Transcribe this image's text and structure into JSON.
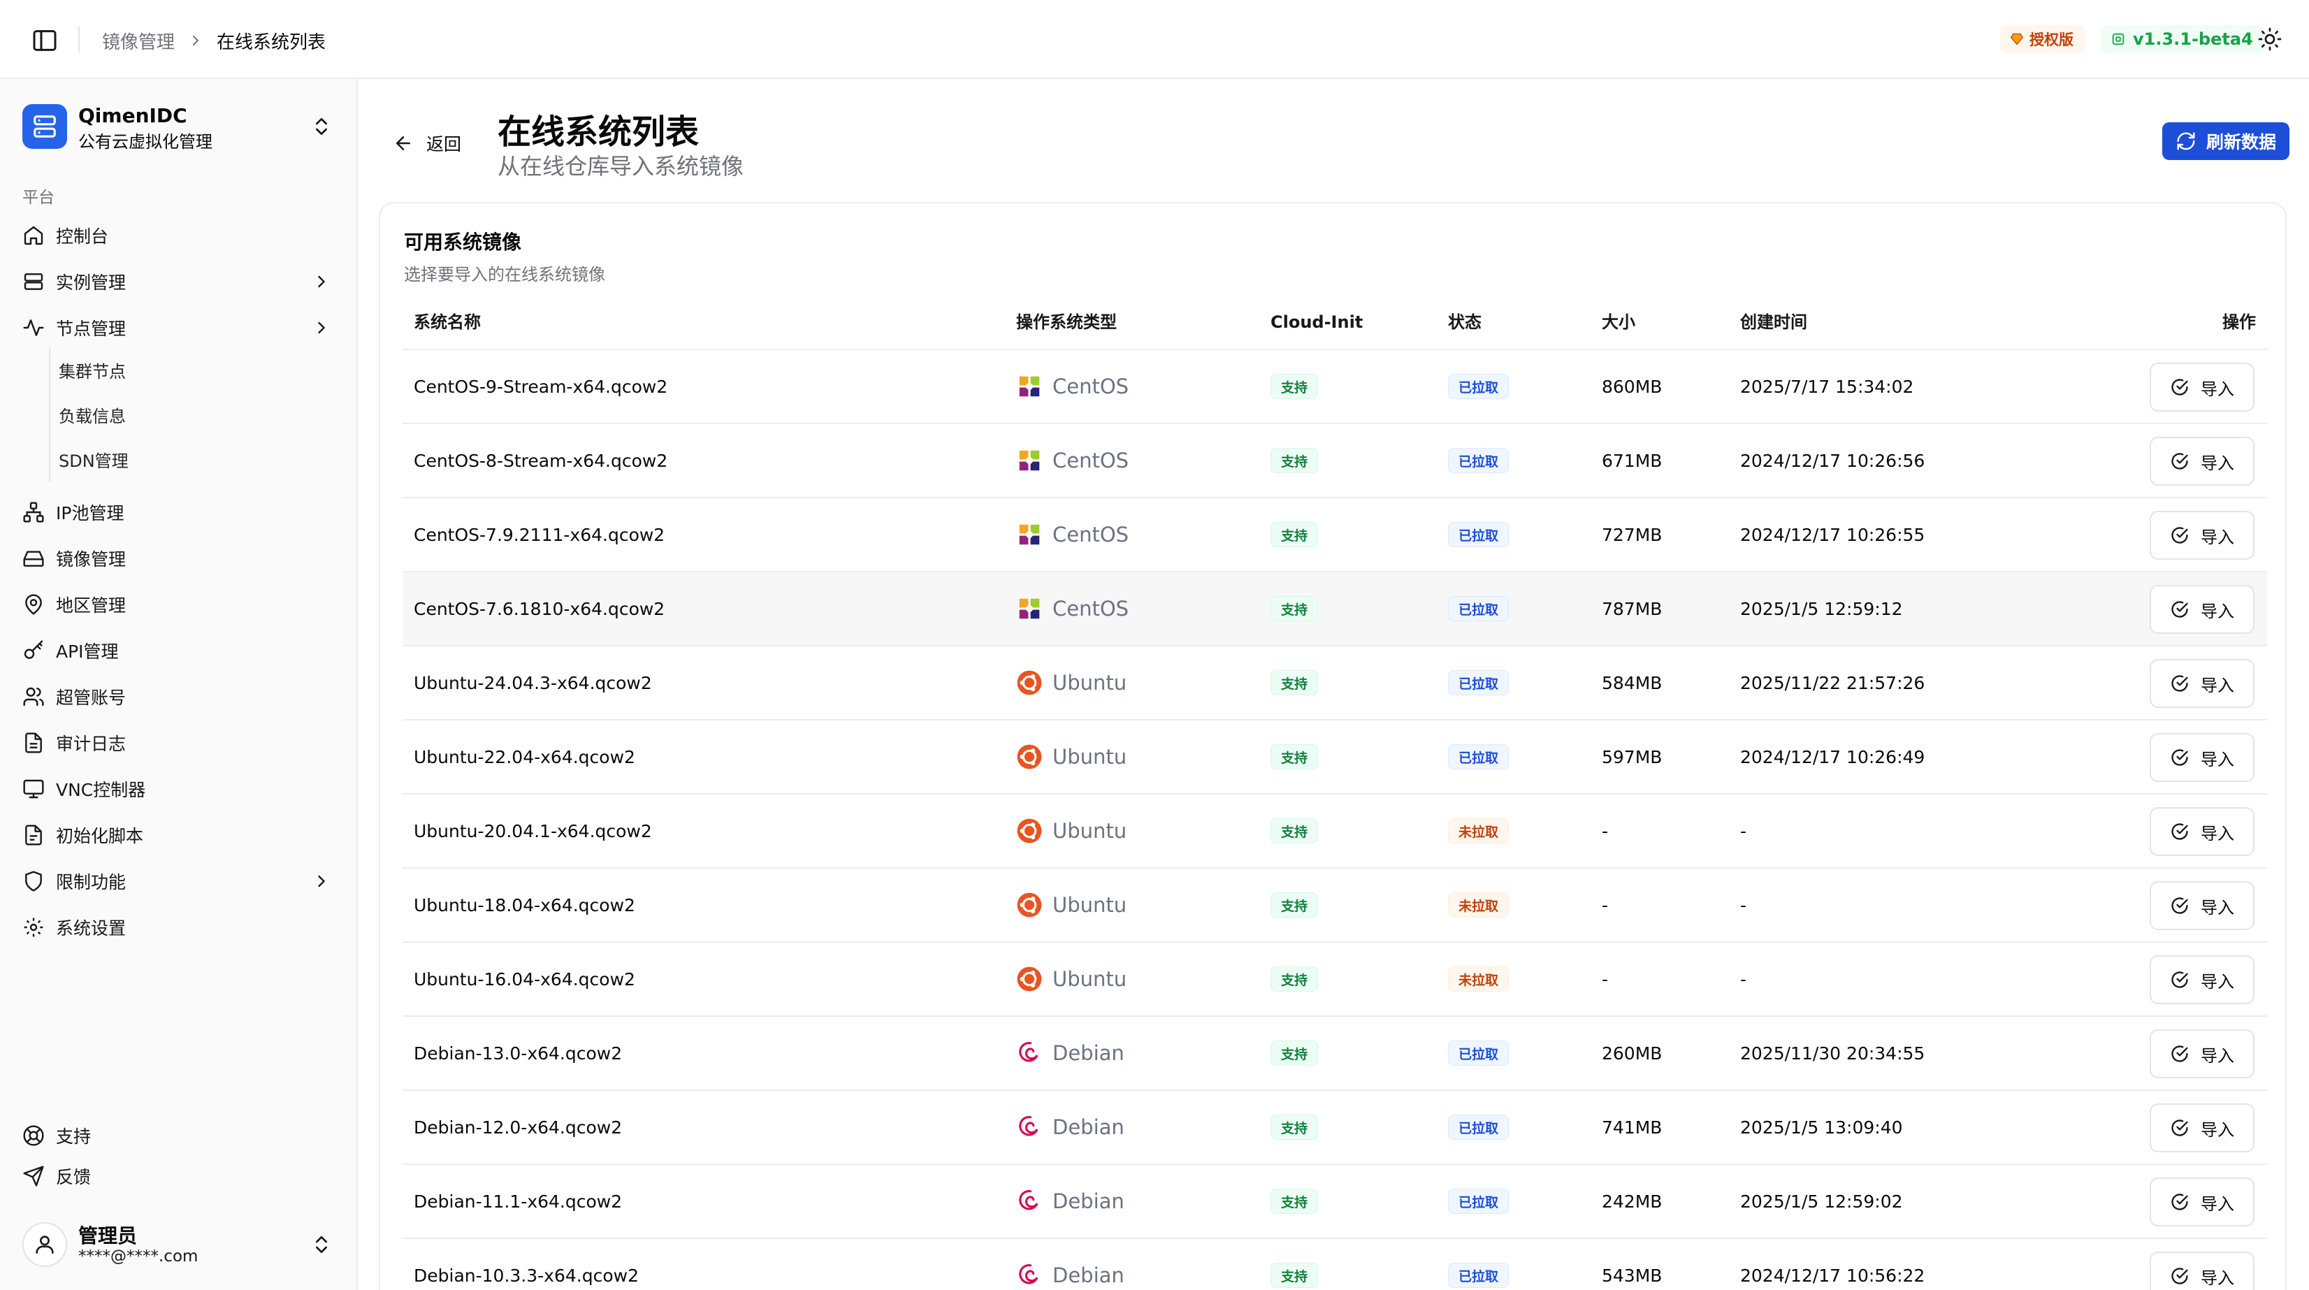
{
  "topbar": {
    "breadcrumb_parent": "镜像管理",
    "breadcrumb_current": "在线系统列表",
    "license_badge": "授权版",
    "version_badge": "v1.3.1-beta4"
  },
  "sidebar": {
    "brand_name": "QimenIDC",
    "brand_sub": "公有云虚拟化管理",
    "group_label": "平台",
    "items": [
      {
        "label": "控制台",
        "icon": "home-icon"
      },
      {
        "label": "实例管理",
        "icon": "server-icon",
        "has_children": true
      },
      {
        "label": "节点管理",
        "icon": "activity-icon",
        "has_children": true,
        "expanded": true
      },
      {
        "label": "IP池管理",
        "icon": "network-icon"
      },
      {
        "label": "镜像管理",
        "icon": "hard-drive-icon"
      },
      {
        "label": "地区管理",
        "icon": "map-pin-icon"
      },
      {
        "label": "API管理",
        "icon": "key-icon"
      },
      {
        "label": "超管账号",
        "icon": "users-icon"
      },
      {
        "label": "审计日志",
        "icon": "file-text-icon"
      },
      {
        "label": "VNC控制器",
        "icon": "monitor-icon"
      },
      {
        "label": "初始化脚本",
        "icon": "file-code-icon"
      },
      {
        "label": "限制功能",
        "icon": "shield-icon",
        "has_children": true
      },
      {
        "label": "系统设置",
        "icon": "settings-icon"
      }
    ],
    "node_children": [
      "集群节点",
      "负载信息",
      "SDN管理"
    ],
    "footer": [
      {
        "label": "支持",
        "icon": "life-buoy-icon"
      },
      {
        "label": "反馈",
        "icon": "send-icon"
      }
    ],
    "user": {
      "name": "管理员",
      "email": "****@****.com"
    }
  },
  "main": {
    "back_label": "返回",
    "title": "在线系统列表",
    "subtitle": "从在线仓库导入系统镜像",
    "refresh_label": "刷新数据",
    "card_title": "可用系统镜像",
    "card_subtitle": "选择要导入的在线系统镜像",
    "columns": [
      "系统名称",
      "操作系统类型",
      "Cloud-Init",
      "状态",
      "大小",
      "创建时间",
      "操作"
    ],
    "import_label": "导入",
    "rows": [
      {
        "name": "CentOS-9-Stream-x64.qcow2",
        "os": "CentOS",
        "cloudinit": "支持",
        "status": "已拉取",
        "status_kind": "pulled",
        "size": "860MB",
        "created": "2025/7/17 15:34:02"
      },
      {
        "name": "CentOS-8-Stream-x64.qcow2",
        "os": "CentOS",
        "cloudinit": "支持",
        "status": "已拉取",
        "status_kind": "pulled",
        "size": "671MB",
        "created": "2024/12/17 10:26:56"
      },
      {
        "name": "CentOS-7.9.2111-x64.qcow2",
        "os": "CentOS",
        "cloudinit": "支持",
        "status": "已拉取",
        "status_kind": "pulled",
        "size": "727MB",
        "created": "2024/12/17 10:26:55"
      },
      {
        "name": "CentOS-7.6.1810-x64.qcow2",
        "os": "CentOS",
        "cloudinit": "支持",
        "status": "已拉取",
        "status_kind": "pulled",
        "size": "787MB",
        "created": "2025/1/5 12:59:12",
        "hover": true
      },
      {
        "name": "Ubuntu-24.04.3-x64.qcow2",
        "os": "Ubuntu",
        "cloudinit": "支持",
        "status": "已拉取",
        "status_kind": "pulled",
        "size": "584MB",
        "created": "2025/11/22 21:57:26"
      },
      {
        "name": "Ubuntu-22.04-x64.qcow2",
        "os": "Ubuntu",
        "cloudinit": "支持",
        "status": "已拉取",
        "status_kind": "pulled",
        "size": "597MB",
        "created": "2024/12/17 10:26:49"
      },
      {
        "name": "Ubuntu-20.04.1-x64.qcow2",
        "os": "Ubuntu",
        "cloudinit": "支持",
        "status": "未拉取",
        "status_kind": "notpulled",
        "size": "-",
        "created": "-"
      },
      {
        "name": "Ubuntu-18.04-x64.qcow2",
        "os": "Ubuntu",
        "cloudinit": "支持",
        "status": "未拉取",
        "status_kind": "notpulled",
        "size": "-",
        "created": "-"
      },
      {
        "name": "Ubuntu-16.04-x64.qcow2",
        "os": "Ubuntu",
        "cloudinit": "支持",
        "status": "未拉取",
        "status_kind": "notpulled",
        "size": "-",
        "created": "-"
      },
      {
        "name": "Debian-13.0-x64.qcow2",
        "os": "Debian",
        "cloudinit": "支持",
        "status": "已拉取",
        "status_kind": "pulled",
        "size": "260MB",
        "created": "2025/11/30 20:34:55"
      },
      {
        "name": "Debian-12.0-x64.qcow2",
        "os": "Debian",
        "cloudinit": "支持",
        "status": "已拉取",
        "status_kind": "pulled",
        "size": "741MB",
        "created": "2025/1/5 13:09:40"
      },
      {
        "name": "Debian-11.1-x64.qcow2",
        "os": "Debian",
        "cloudinit": "支持",
        "status": "已拉取",
        "status_kind": "pulled",
        "size": "242MB",
        "created": "2025/1/5 12:59:02"
      },
      {
        "name": "Debian-10.3.3-x64.qcow2",
        "os": "Debian",
        "cloudinit": "支持",
        "status": "已拉取",
        "status_kind": "pulled",
        "size": "543MB",
        "created": "2024/12/17 10:56:22"
      }
    ]
  },
  "colors": {
    "accent": "#1d4ed8",
    "brand": "#2563eb",
    "success": "#15803d",
    "pulled": "#1d4ed8",
    "not_pulled": "#c2410c",
    "license": "#c2410c",
    "version": "#16a34a"
  }
}
